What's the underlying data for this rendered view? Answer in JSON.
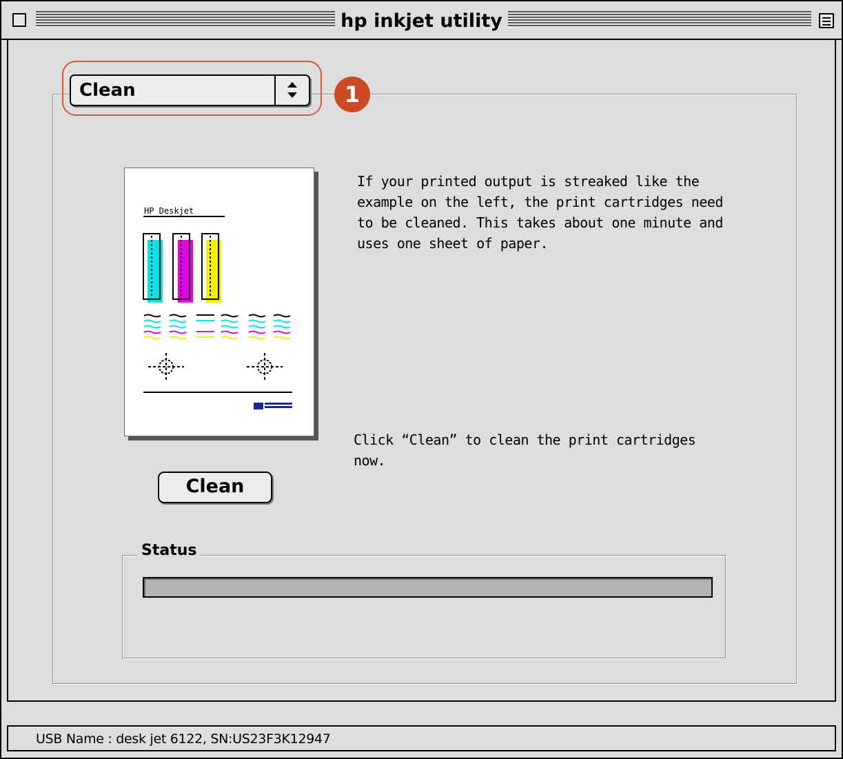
{
  "window": {
    "title": "hp inkjet utility"
  },
  "panel_select": {
    "selected": "Clean",
    "callout_number": "1"
  },
  "illustration": {
    "header_text": "HP Deskjet",
    "colors": {
      "cyan": "#00e5e5",
      "magenta": "#e000e0",
      "yellow": "#f0f000"
    }
  },
  "main": {
    "description": "If your printed output is streaked like the example on the left, the print cartridges need to be cleaned.  This takes about one minute and uses one sheet of paper.",
    "description_lines": [
      "If your printed output is streaked like the",
      "example on the left, the print cartridges need",
      "to be cleaned.  This takes about one minute and",
      "uses one sheet of paper."
    ],
    "instruction_lines": [
      "Click “Clean” to clean the print cartridges",
      "now."
    ],
    "clean_button_label": "Clean"
  },
  "status": {
    "label": "Status",
    "progress": 0.0
  },
  "footer": {
    "usb_info": "USB Name : desk jet 6122, SN:US23F3K12947"
  },
  "theme": {
    "accent": "#cc4b25",
    "window_bg": "#dddddd"
  }
}
